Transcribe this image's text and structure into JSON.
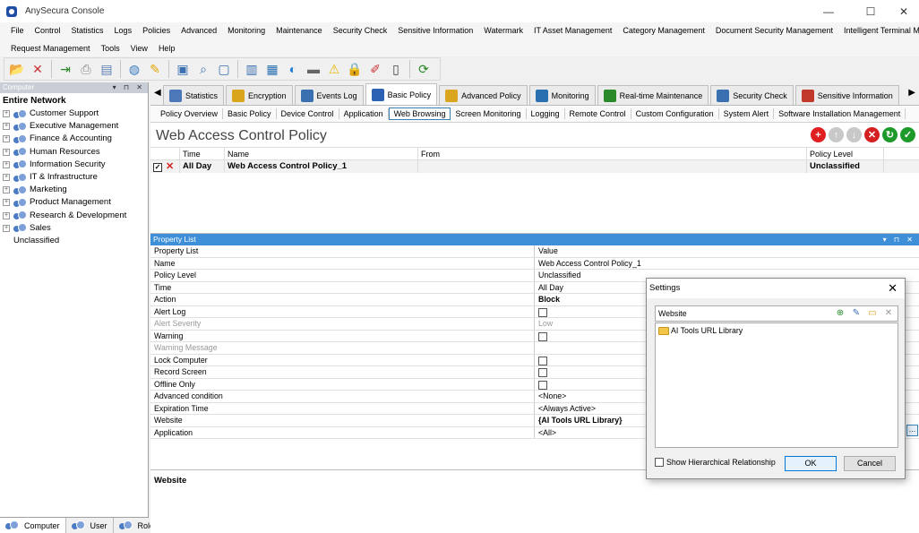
{
  "window": {
    "title": "AnySecura Console"
  },
  "menu": {
    "row1": [
      "File",
      "Control",
      "Statistics",
      "Logs",
      "Policies",
      "Advanced",
      "Monitoring",
      "Maintenance",
      "Security Check",
      "Sensitive Information",
      "Watermark",
      "IT Asset Management",
      "Category Management",
      "Document Security Management",
      "Intelligent Terminal Management"
    ],
    "row2": [
      "Request Management",
      "Tools",
      "View",
      "Help"
    ]
  },
  "left_panel": {
    "header": "Computer",
    "root": "Entire Network",
    "groups": [
      "Customer Support",
      "Executive Management",
      "Finance & Accounting",
      "Human Resources",
      "Information Security",
      "IT & Infrastructure",
      "Marketing",
      "Product Management",
      "Research & Development",
      "Sales"
    ],
    "unclassified": "Unclassified",
    "bottom_tabs": [
      "Computer",
      "User",
      "Role"
    ]
  },
  "module_tabs": [
    "Statistics",
    "Encryption",
    "Events Log",
    "Basic Policy",
    "Advanced Policy",
    "Monitoring",
    "Real-time Maintenance",
    "Security Check",
    "Sensitive Information"
  ],
  "sub_tabs": [
    "Policy Overview",
    "Basic Policy",
    "Device Control",
    "Application",
    "Web Browsing",
    "Screen Monitoring",
    "Logging",
    "Remote Control",
    "Custom Configuration",
    "System Alert",
    "Software Installation Management"
  ],
  "policy": {
    "title": "Web Access Control Policy",
    "columns": [
      "Time",
      "Name",
      "From",
      "Policy Level"
    ],
    "row": {
      "time": "All Day",
      "name": "Web Access Control Policy_1",
      "from": "",
      "level": "Unclassified"
    }
  },
  "property_list": {
    "header": "Property List",
    "col_name": "Property List",
    "col_value": "Value",
    "rows": [
      {
        "name": "Name",
        "value": "Web Access Control Policy_1"
      },
      {
        "name": "Policy Level",
        "value": "Unclassified"
      },
      {
        "name": "Time",
        "value": "All Day"
      },
      {
        "name": "Action",
        "value": "Block"
      },
      {
        "name": "Alert Log",
        "value": ""
      },
      {
        "name": "Alert Severity",
        "value": "Low"
      },
      {
        "name": "Warning",
        "value": ""
      },
      {
        "name": "Warning Message",
        "value": ""
      },
      {
        "name": "Lock Computer",
        "value": ""
      },
      {
        "name": "Record Screen",
        "value": ""
      },
      {
        "name": "Offline Only",
        "value": ""
      },
      {
        "name": "Advanced condition",
        "value": "<None>"
      },
      {
        "name": "Expiration Time",
        "value": "<Always Active>"
      },
      {
        "name": "Website",
        "value": "{AI Tools URL Library}"
      },
      {
        "name": "Application",
        "value": "<All>"
      }
    ],
    "description_title": "Website"
  },
  "dialog": {
    "title": "Settings",
    "list_header": "Website",
    "item": "AI Tools URL Library",
    "checkbox_label": "Show Hierarchical Relationship",
    "ok": "OK",
    "cancel": "Cancel"
  },
  "colors": {
    "accent": "#3e8fd8",
    "selected_border": "#3c7fb1"
  }
}
